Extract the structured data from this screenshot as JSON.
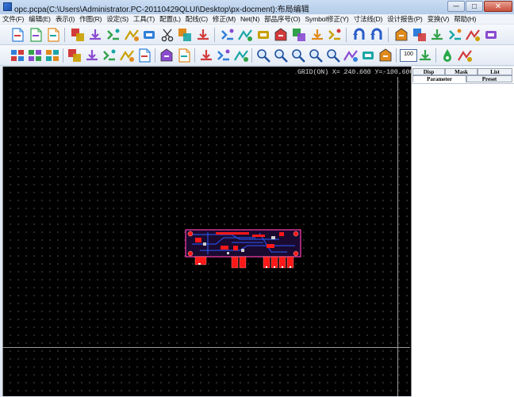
{
  "window": {
    "title": "opc.pcpa(C:\\Users\\Administrator.PC-20110429QLUI\\Desktop\\px-docment):布局编辑",
    "minimize_label": "─",
    "maximize_label": "□",
    "close_label": "✕"
  },
  "menu": [
    "文件(F)",
    "编辑(E)",
    "表示(I)",
    "作图(R)",
    "设定(S)",
    "工具(T)",
    "配置(L)",
    "配线(C)",
    "修正(M)",
    "Net(N)",
    "部品序号(O)",
    "Symbol修正(Y)",
    "寸法线(D)",
    "设计报告(P)",
    "变换(V)",
    "帮助(H)"
  ],
  "toolbar1": [
    "new-file-icon",
    "open-file-icon",
    "save-file-icon",
    "route-net-icon",
    "add-trace-icon",
    "arc-icon",
    "bend-icon",
    "miter-icon",
    "cut-icon",
    "link-icon",
    "move-part-icon",
    "stretch-icon",
    "fill-icon",
    "flip-icon",
    "align-icon",
    "swap-icon",
    "pin-icon",
    "wire-icon",
    "undo-icon",
    "redo-icon",
    "copy-part-icon",
    "delete-part-icon",
    "place-part-icon",
    "group-icon",
    "ungroup-icon",
    "replace-icon"
  ],
  "toolbar2": [
    "layer-grid-icon",
    "tile-view-icon",
    "window-grid-icon",
    "measure-icon",
    "net-list-icon",
    "help-query-icon",
    "part-edit-icon",
    "part-report-icon",
    "board-outline-icon",
    "doc-view-icon",
    "drc-check-icon",
    "text-icon",
    "layers-icon",
    "zoom-fit-icon",
    "zoom-window-icon",
    "zoom-scale-icon",
    "zoom-out-icon",
    "zoom-in-icon",
    "pen-icon",
    "route-auto-icon",
    "route-manual-icon",
    "zoom-100-icon",
    "fit-width-icon",
    "drop-icon",
    "cursor-icon"
  ],
  "zoom_label": "100",
  "status": {
    "readout": "GRID(ON) X= 240.600 Y=-100.600"
  },
  "panel": {
    "tabs_row1": [
      "Disp",
      "Mask",
      "List"
    ],
    "tabs_row2": [
      "Parameter",
      "Preset"
    ]
  },
  "colors": {
    "canvas": "#000000",
    "board_outline": "#ff3fb0",
    "copper": "#ff1818",
    "trace_blue": "#2a5cff"
  }
}
